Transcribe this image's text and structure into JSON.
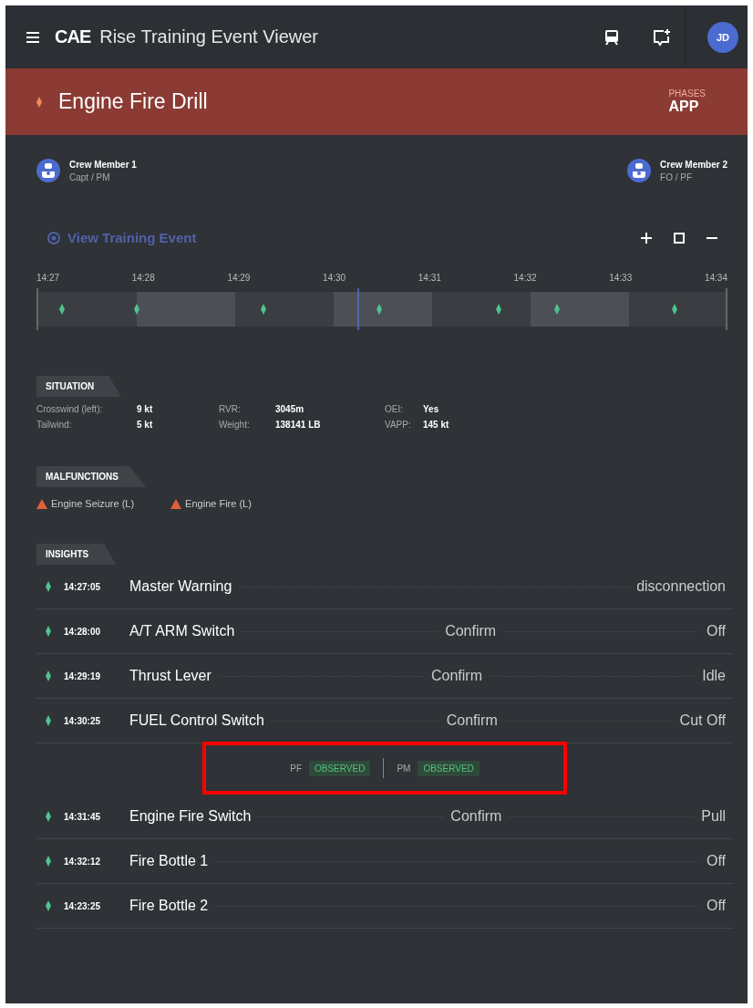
{
  "header": {
    "brand": "CAE",
    "title": "Rise Training Event Viewer",
    "avatar": "JD"
  },
  "event": {
    "title": "Engine Fire Drill",
    "phase_label": "PHASES",
    "phase": "APP"
  },
  "crew": [
    {
      "name": "Crew Member 1",
      "role": "Capt / PM"
    },
    {
      "name": "Crew Member 2",
      "role": "FO / PF"
    }
  ],
  "view_link": "View Training Event",
  "timeline": {
    "ticks": [
      "14:27",
      "14:28",
      "14:29",
      "14:30",
      "14:31",
      "14:32",
      "14:33",
      "14:34"
    ]
  },
  "situation": {
    "title": "SITUATION",
    "items": [
      {
        "label": "Crosswind (left):",
        "value": "9 kt"
      },
      {
        "label": "RVR:",
        "value": "3045m"
      },
      {
        "label": "OEI:",
        "value": "Yes"
      },
      {
        "label": "Tailwind:",
        "value": "5 kt"
      },
      {
        "label": "Weight:",
        "value": "138141 LB"
      },
      {
        "label": "VAPP:",
        "value": "145 kt"
      }
    ]
  },
  "malfunctions": {
    "title": "MALFUNCTIONS",
    "items": [
      "Engine Seizure (L)",
      "Engine Fire (L)"
    ]
  },
  "insights": {
    "title": "INSIGHTS",
    "rows": [
      {
        "time": "14:27:05",
        "name": "Master Warning",
        "value": "disconnection"
      },
      {
        "time": "14:28:00",
        "name": "A/T ARM Switch",
        "action": "Confirm",
        "value": "Off"
      },
      {
        "time": "14:29:19",
        "name": "Thrust Lever",
        "action": "Confirm",
        "value": "Idle"
      },
      {
        "time": "14:30:25",
        "name": "FUEL Control Switch",
        "action": "Confirm",
        "value": "Cut Off",
        "observations": [
          {
            "role": "PF",
            "status": "OBSERVED"
          },
          {
            "role": "PM",
            "status": "OBSERVED"
          }
        ]
      },
      {
        "time": "14:31:45",
        "name": "Engine Fire Switch",
        "action": "Confirm",
        "value": "Pull"
      },
      {
        "time": "14:32:12",
        "name": "Fire Bottle 1",
        "value": "Off"
      },
      {
        "time": "14:23:25",
        "name": "Fire Bottle 2",
        "value": "Off"
      }
    ]
  }
}
